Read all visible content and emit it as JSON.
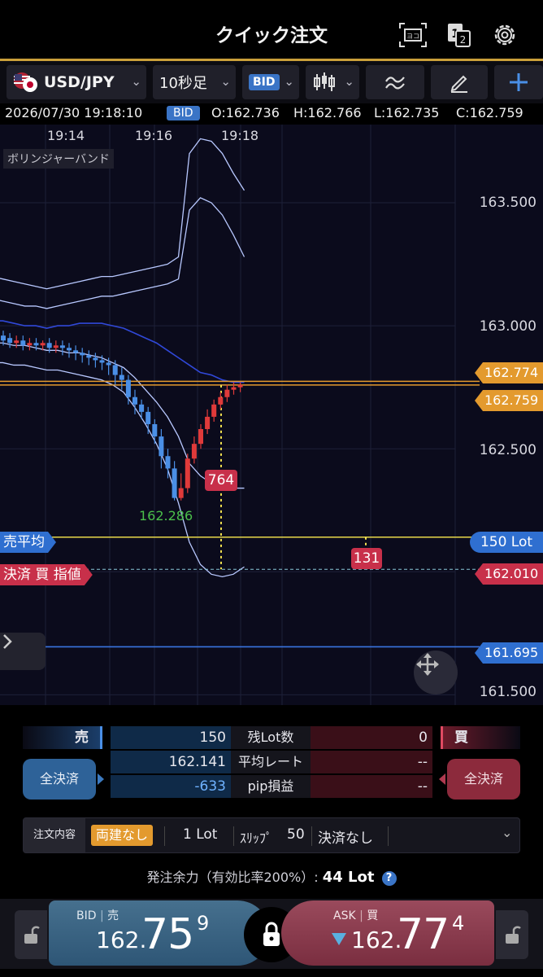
{
  "header": {
    "title": "クイック注文",
    "icons": [
      "tick-screen-icon",
      "split-1-2-icon",
      "gear-icon"
    ]
  },
  "toolbar": {
    "pair": "USD/JPY",
    "timeframe": "10秒足",
    "price_side": "BID",
    "chart_type_icon": "candlestick-icon",
    "indicator_icon": "indicator-wave-icon",
    "draw_icon": "pencil-icon",
    "add_icon": "plus-icon",
    "colors": {
      "accent": "#3a74c6",
      "gold": "#caa03a"
    }
  },
  "ohlc": {
    "datetime": "2026/07/30 19:18:10",
    "side": "BID",
    "open": "O:162.736",
    "high": "H:162.766",
    "low": "L:162.735",
    "close": "C:162.759"
  },
  "chart": {
    "time_labels": [
      "19:14",
      "19:16",
      "19:18"
    ],
    "indicator_label": "ボリンジャーバンド",
    "price_labels": [
      "163.500",
      "163.000",
      "162.500",
      "161.500"
    ],
    "tag_ask": "162.774",
    "tag_bid": "162.759",
    "tag_blue": "161.695",
    "tag_limit": "162.010",
    "sell_avg_label": "売平均",
    "sell_avg_lots": "150 Lot",
    "limit_label": "決済 買 指値",
    "pips_up": "764",
    "pips_down": "131",
    "low_marker": "162.286",
    "expand_icon": "chevron-right-icon",
    "move_icon": "move-arrows-icon"
  },
  "chart_data": {
    "type": "candlestick",
    "x": [
      "19:14",
      "19:16",
      "19:18"
    ],
    "ylim": [
      161.45,
      163.75
    ],
    "lines": {
      "ask": 162.774,
      "bid": 162.759,
      "sell_average": 162.141,
      "limit": 162.01,
      "blue": 161.695
    },
    "low_marker": 162.286,
    "candles": [
      [
        162.96,
        162.94,
        162.98,
        162.92
      ],
      [
        162.95,
        162.93,
        162.97,
        162.91
      ],
      [
        162.93,
        162.94,
        162.96,
        162.91
      ],
      [
        162.94,
        162.92,
        162.96,
        162.9
      ],
      [
        162.92,
        162.93,
        162.95,
        162.9
      ],
      [
        162.93,
        162.92,
        162.95,
        162.9
      ],
      [
        162.92,
        162.93,
        162.94,
        162.9
      ],
      [
        162.93,
        162.91,
        162.95,
        162.89
      ],
      [
        162.91,
        162.92,
        162.94,
        162.89
      ],
      [
        162.92,
        162.91,
        162.94,
        162.88
      ],
      [
        162.91,
        162.9,
        162.93,
        162.87
      ],
      [
        162.9,
        162.89,
        162.92,
        162.86
      ],
      [
        162.89,
        162.88,
        162.91,
        162.85
      ],
      [
        162.88,
        162.87,
        162.9,
        162.84
      ],
      [
        162.87,
        162.86,
        162.89,
        162.83
      ],
      [
        162.86,
        162.85,
        162.88,
        162.82
      ],
      [
        162.85,
        162.84,
        162.87,
        162.8
      ],
      [
        162.84,
        162.8,
        162.86,
        162.76
      ],
      [
        162.8,
        162.78,
        162.83,
        162.74
      ],
      [
        162.78,
        162.71,
        162.8,
        162.68
      ],
      [
        162.71,
        162.68,
        162.74,
        162.64
      ],
      [
        162.68,
        162.65,
        162.7,
        162.62
      ],
      [
        162.65,
        162.6,
        162.67,
        162.56
      ],
      [
        162.6,
        162.55,
        162.62,
        162.52
      ],
      [
        162.55,
        162.47,
        162.58,
        162.42
      ],
      [
        162.47,
        162.42,
        162.5,
        162.38
      ],
      [
        162.42,
        162.3,
        162.45,
        162.29
      ],
      [
        162.3,
        162.34,
        162.4,
        162.29
      ],
      [
        162.34,
        162.46,
        162.48,
        162.32
      ],
      [
        162.46,
        162.52,
        162.55,
        162.44
      ],
      [
        162.52,
        162.58,
        162.6,
        162.5
      ],
      [
        162.58,
        162.63,
        162.66,
        162.56
      ],
      [
        162.63,
        162.68,
        162.7,
        162.61
      ],
      [
        162.68,
        162.71,
        162.73,
        162.66
      ],
      [
        162.71,
        162.74,
        162.76,
        162.69
      ],
      [
        162.74,
        162.75,
        162.77,
        162.72
      ],
      [
        162.75,
        162.76,
        162.77,
        162.73
      ]
    ],
    "bands": {
      "upper2": [
        163.2,
        163.19,
        163.18,
        163.17,
        163.16,
        163.15,
        163.16,
        163.17,
        163.18,
        163.19,
        163.2,
        163.2,
        163.21,
        163.22,
        163.23,
        163.24,
        163.25,
        163.28,
        163.7,
        163.76,
        163.75,
        163.7,
        163.62,
        163.55
      ],
      "upper1": [
        163.11,
        163.1,
        163.09,
        163.08,
        163.08,
        163.07,
        163.08,
        163.09,
        163.1,
        163.11,
        163.12,
        163.12,
        163.13,
        163.14,
        163.15,
        163.16,
        163.17,
        163.19,
        163.47,
        163.52,
        163.5,
        163.45,
        163.37,
        163.28
      ],
      "mid": [
        163.02,
        163.02,
        163.01,
        163.0,
        163.0,
        162.99,
        163.0,
        163.0,
        163.01,
        163.01,
        163.01,
        163.0,
        162.99,
        162.97,
        162.95,
        162.93,
        162.9,
        162.87,
        162.84,
        162.81,
        162.8,
        162.78,
        162.77,
        162.77
      ],
      "lower1": [
        162.93,
        162.93,
        162.92,
        162.92,
        162.91,
        162.9,
        162.9,
        162.89,
        162.89,
        162.88,
        162.87,
        162.85,
        162.83,
        162.79,
        162.74,
        162.69,
        162.63,
        162.55,
        162.44,
        162.39,
        162.36,
        162.35,
        162.34,
        162.34
      ],
      "lower2": [
        162.85,
        162.85,
        162.84,
        162.84,
        162.83,
        162.82,
        162.82,
        162.81,
        162.8,
        162.79,
        162.78,
        162.76,
        162.73,
        162.67,
        162.6,
        162.52,
        162.42,
        162.28,
        162.12,
        162.03,
        161.99,
        161.98,
        161.99,
        162.02
      ]
    }
  },
  "panel": {
    "sell_label": "売",
    "buy_label": "買",
    "close_all_sell": "全決済",
    "close_all_buy": "全決済",
    "rows": [
      {
        "sell": "150",
        "label": "残Lot数",
        "buy": "0"
      },
      {
        "sell": "162.141",
        "label": "平均レート",
        "buy": "--"
      },
      {
        "sell": "-633",
        "label": "pip損益",
        "buy": "--"
      }
    ],
    "order": {
      "label": "注文内容",
      "hedge": "両建なし",
      "lot": "1 Lot",
      "slip_label": "ｽﾘｯﾌﾟ",
      "slip": "50",
      "close": "決済なし"
    },
    "margin": {
      "label": "発注余力（有効比率200%）:",
      "value": "44 Lot"
    }
  },
  "bottom": {
    "bid": {
      "label": "BID",
      "side": "売",
      "big": "162.",
      "mid": "75",
      "small": "9"
    },
    "ask": {
      "label": "ASK",
      "side": "買",
      "big": "162.",
      "mid": "77",
      "small": "4"
    }
  }
}
